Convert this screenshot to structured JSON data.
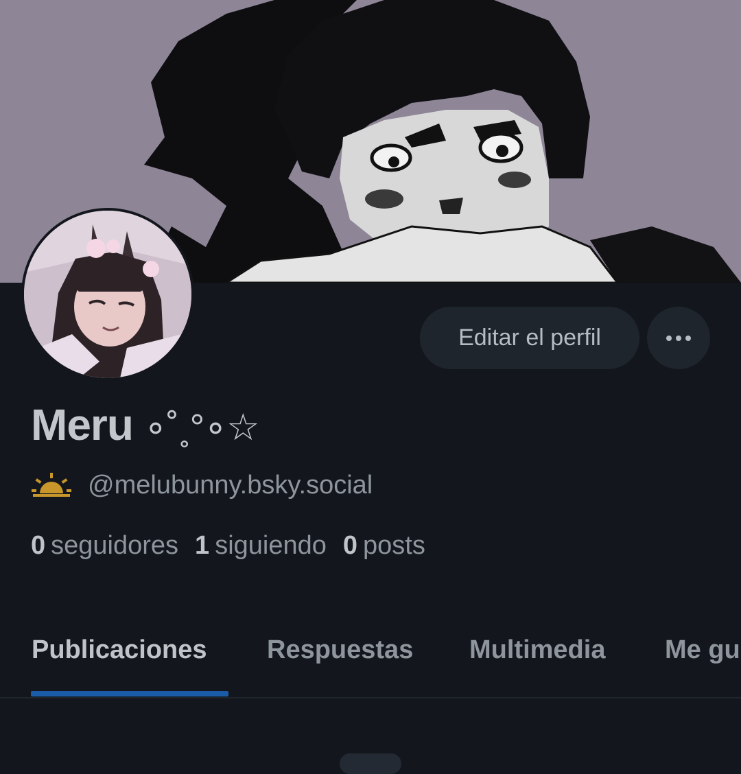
{
  "profile": {
    "display_name": "Meru",
    "name_decoration": "∘˚˳°∘☆",
    "handle": "@melubunny.bsky.social",
    "handle_icon": "sun-icon"
  },
  "actions": {
    "edit_label": "Editar el perfil",
    "more_icon": "ellipsis-icon"
  },
  "stats": [
    {
      "count": "0",
      "label": "seguidores"
    },
    {
      "count": "1",
      "label": "siguiendo"
    },
    {
      "count": "0",
      "label": "posts"
    }
  ],
  "tabs": [
    {
      "label": "Publicaciones",
      "active": true
    },
    {
      "label": "Respuestas",
      "active": false
    },
    {
      "label": "Multimedia",
      "active": false
    },
    {
      "label": "Me gusta",
      "active": false
    }
  ],
  "colors": {
    "background": "#13171d",
    "accent": "#1a5ca8",
    "button_bg": "#1f252d",
    "sun_icon": "#c8962a"
  }
}
